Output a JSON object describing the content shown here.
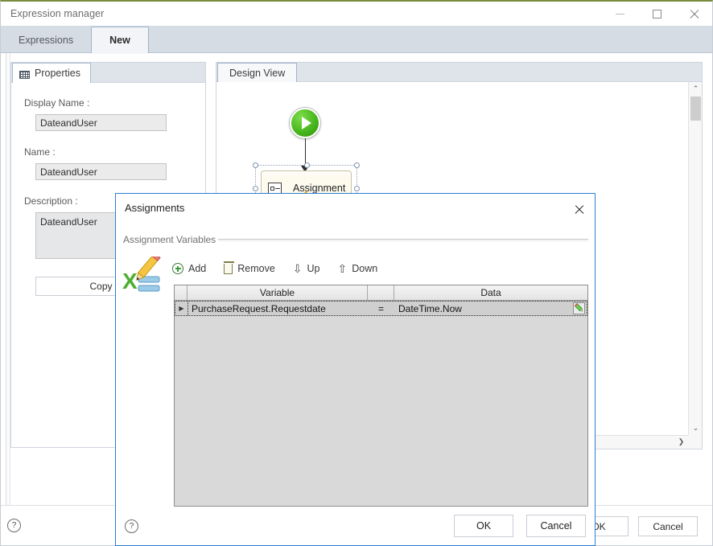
{
  "window": {
    "title": "Expression manager",
    "controls": {
      "minimize": "minimize-icon",
      "maximize": "maximize-icon",
      "close": "close-icon"
    }
  },
  "tabs": [
    {
      "label": "Expressions",
      "active": false
    },
    {
      "label": "New",
      "active": true
    }
  ],
  "properties_panel": {
    "tab_label": "Properties",
    "tab_icon": "properties-grid-icon",
    "fields": [
      {
        "label": "Display Name :",
        "value": "DateandUser"
      },
      {
        "label": "Name :",
        "value": "DateandUser"
      },
      {
        "label": "Description :",
        "value": "DateandUser"
      }
    ],
    "copy_button": "Copy"
  },
  "design_panel": {
    "tab_label": "Design View",
    "nodes": [
      {
        "type": "start",
        "icon": "start-play-icon"
      },
      {
        "type": "activity",
        "label": "Assignment",
        "icon": "assignment-icon",
        "badge": "warning-icon",
        "selected": true
      }
    ],
    "scroll": {
      "up_arrow": "⌃",
      "down_arrow": "⌄",
      "right_arrow": "❯"
    }
  },
  "main_footer": {
    "help": "?",
    "ok": "OK",
    "cancel": "Cancel"
  },
  "dialog": {
    "title": "Assignments",
    "close_icon": "close-icon",
    "group_label": "Assignment Variables",
    "side_icon": "excel-pencil-icon",
    "toolbar": [
      {
        "label": "Add",
        "icon": "plus-circle-icon"
      },
      {
        "label": "Remove",
        "icon": "trash-icon"
      },
      {
        "label": "Up",
        "icon": "arrow-down-outline-icon",
        "glyph": "⇩"
      },
      {
        "label": "Down",
        "icon": "arrow-up-outline-icon",
        "glyph": "⇧"
      }
    ],
    "table": {
      "columns": [
        "",
        "Variable",
        "",
        "Data"
      ],
      "header_variable": "Variable",
      "header_data": "Data",
      "rows": [
        {
          "marker": "▶",
          "variable": "PurchaseRequest.Requestdate",
          "operator": "=",
          "data": "DateTime.Now",
          "edit_icon": "pencil-edit-icon",
          "selected": true
        }
      ]
    },
    "footer": {
      "help": "?",
      "ok": "OK",
      "cancel": "Cancel"
    }
  }
}
